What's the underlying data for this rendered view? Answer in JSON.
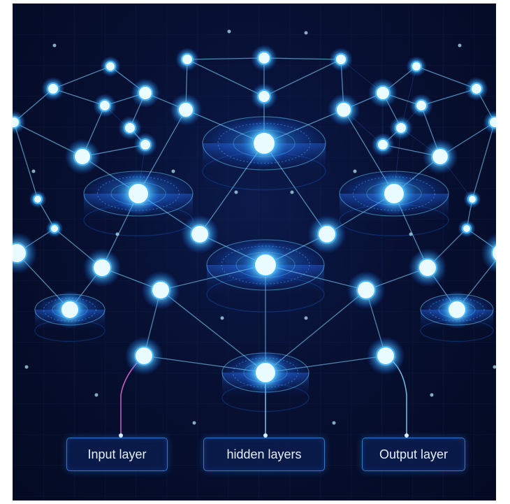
{
  "diagram": {
    "labels": {
      "input": "Input layer",
      "hidden": "hidden layers",
      "output": "Output layer"
    },
    "colors": {
      "background": "#050c26",
      "edge": "#7fd6ff",
      "node_core": "#e9fbff",
      "node_glow": "#3fb4ff",
      "platform": "#1b5fd6",
      "label_border": "#2d79c9"
    }
  }
}
